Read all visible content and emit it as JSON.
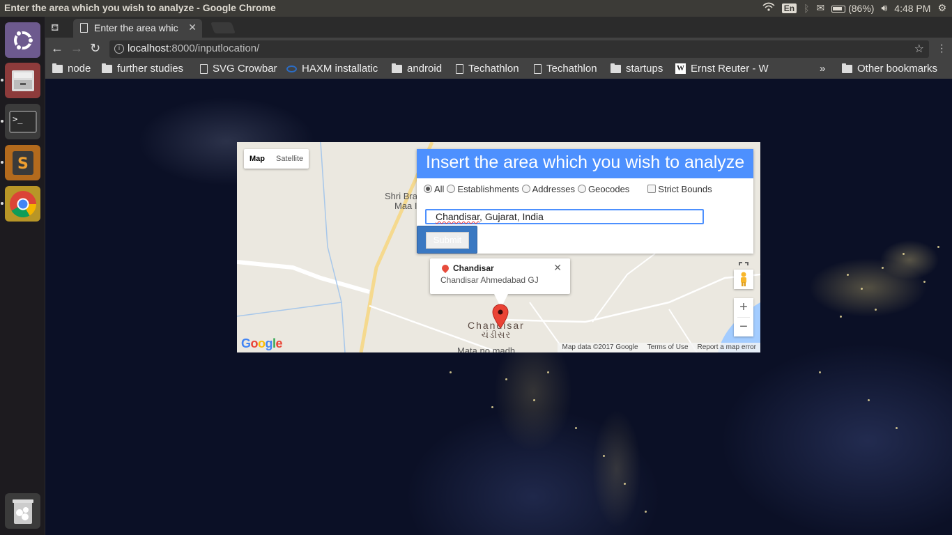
{
  "system": {
    "window_title": "Enter the area which you wish to analyze - Google Chrome",
    "keyboard": "En",
    "battery": "(86%)",
    "time": "4:48 PM"
  },
  "browser": {
    "tab_title": "Enter the area whic",
    "url_host": "localhost",
    "url_rest": ":8000/inputlocation/",
    "bookmarks": [
      {
        "label": "node",
        "icon": "folder-icon"
      },
      {
        "label": "further studies",
        "icon": "folder-icon"
      },
      {
        "label": "SVG Crowbar",
        "icon": "page-icon"
      },
      {
        "label": "HAXM installatic",
        "icon": "haxm-icon"
      },
      {
        "label": "android",
        "icon": "folder-icon"
      },
      {
        "label": "Techathlon",
        "icon": "page-icon"
      },
      {
        "label": "Techathlon",
        "icon": "page-icon"
      },
      {
        "label": "startups",
        "icon": "folder-icon"
      },
      {
        "label": "Ernst Reuter - W",
        "icon": "wikipedia-icon"
      }
    ],
    "overflow": "»",
    "other_bookmarks": "Other bookmarks"
  },
  "map": {
    "type_map": "Map",
    "type_satellite": "Satellite",
    "place_label_1": "Shri Bra",
    "place_label_2": "Maa I",
    "place_label_3": "Mata no madh",
    "chandisar_label": "Chandisar",
    "chandisar_label_local": "ચંડીસર",
    "google_logo": "Google",
    "footer": {
      "map_data": "Map data ©2017 Google",
      "terms": "Terms of Use",
      "report": "Report a map error"
    },
    "info_window": {
      "title": "Chandisar",
      "subtitle": "Chandisar Ahmedabad GJ"
    },
    "zoom_in": "+",
    "zoom_out": "−"
  },
  "form": {
    "title": "Insert the area which you wish to analyze",
    "radios": [
      {
        "label": "All",
        "checked": true
      },
      {
        "label": "Establishments",
        "checked": false
      },
      {
        "label": "Addresses",
        "checked": false
      },
      {
        "label": "Geocodes",
        "checked": false
      }
    ],
    "strict_bounds": "Strict Bounds",
    "input_word": "Chandisar",
    "input_rest": ", Gujarat, India",
    "submit": "Submit"
  }
}
